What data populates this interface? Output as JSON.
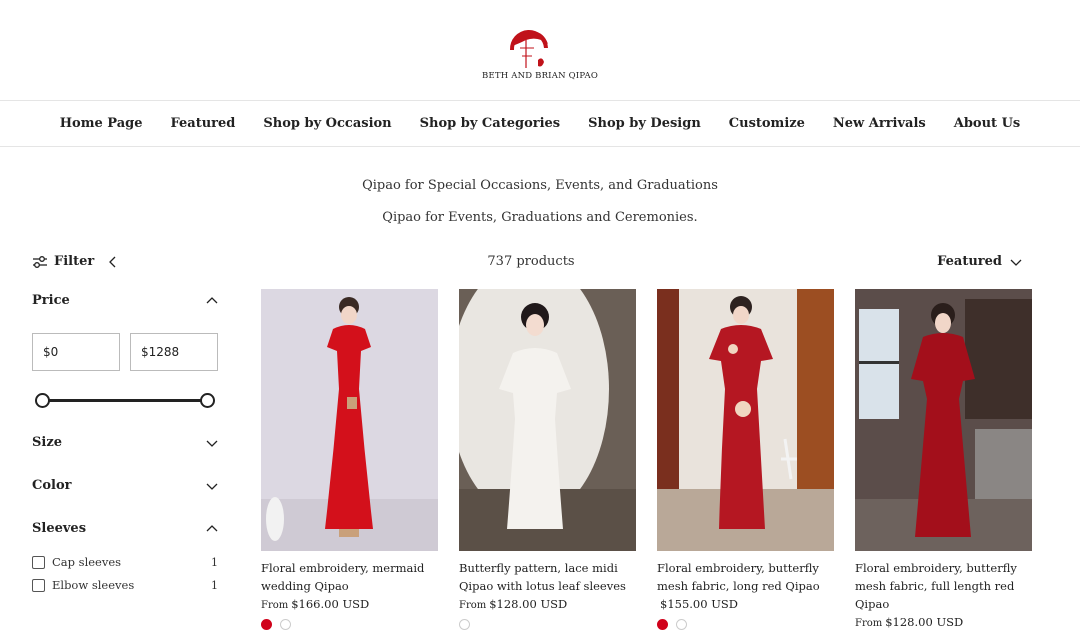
{
  "brand": {
    "name": "BETH AND BRIAN QIPAO",
    "logo_color": "#c0121a"
  },
  "nav": {
    "items": [
      "Home Page",
      "Featured",
      "Shop by Occasion",
      "Shop by Categories",
      "Shop by Design",
      "Customize",
      "New Arrivals",
      "About Us"
    ]
  },
  "collection": {
    "title": "Qipao for Special Occasions, Events, and Graduations",
    "description": "Qipao for Events, Graduations and Ceremonies."
  },
  "toolbar": {
    "filter_label": "Filter",
    "product_count": "737 products",
    "sort_label": "Featured"
  },
  "filters": {
    "price": {
      "label": "Price",
      "min_value": "$0",
      "max_value": "$1288",
      "slider_min_fraction": 0,
      "slider_max_fraction": 1
    },
    "size": {
      "label": "Size"
    },
    "color": {
      "label": "Color"
    },
    "sleeves": {
      "label": "Sleeves",
      "options": [
        {
          "label": "Cap sleeves",
          "count": "1"
        },
        {
          "label": "Elbow sleeves",
          "count": "1"
        }
      ]
    }
  },
  "products": [
    {
      "title": "Floral embroidery, mermaid wedding Qipao",
      "from": "From",
      "price": "$166.00 USD",
      "swatches": [
        "#d0021b",
        "#ffffff"
      ],
      "dress_color": "#d3101b",
      "bg_color": "#dcd8e2"
    },
    {
      "title": "Butterfly pattern, lace midi Qipao with lotus leaf sleeves",
      "from": "From",
      "price": "$128.00 USD",
      "swatches": [
        "#ffffff"
      ],
      "dress_color": "#f4f2ee",
      "bg_color": "#6a5f56"
    },
    {
      "title": "Floral embroidery, butterfly mesh fabric, long red Qipao",
      "from": "",
      "price": "$155.00 USD",
      "swatches": [
        "#d0021b",
        "#ffffff"
      ],
      "dress_color": "#b51722",
      "bg_color": "#e9e3dc"
    },
    {
      "title": "Floral embroidery, butterfly mesh fabric, full length red Qipao",
      "from": "From",
      "price": "$128.00 USD",
      "swatches": [],
      "dress_color": "#a30f1b",
      "bg_color": "#5b4d4a"
    }
  ]
}
